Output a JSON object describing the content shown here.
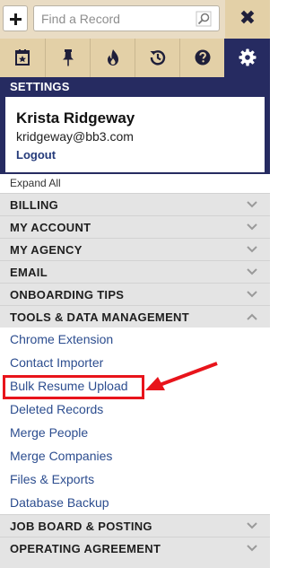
{
  "toolbar": {
    "add_label": "+",
    "search_placeholder": "Find a Record",
    "close_label": "✖"
  },
  "tabs": [
    {
      "icon": "calendar-star-icon"
    },
    {
      "icon": "pin-icon"
    },
    {
      "icon": "flame-icon"
    },
    {
      "icon": "history-icon"
    },
    {
      "icon": "help-icon"
    },
    {
      "icon": "gear-icon",
      "active": true
    }
  ],
  "settings": {
    "header": "SETTINGS",
    "profile": {
      "name": "Krista Ridgeway",
      "email": "kridgeway@bb3.com",
      "logout": "Logout"
    },
    "expand_all": "Expand All"
  },
  "menu": {
    "billing": "BILLING",
    "my_account": "MY ACCOUNT",
    "my_agency": "MY AGENCY",
    "email": "EMAIL",
    "onboarding_tips": "ONBOARDING TIPS",
    "tools": {
      "label": "TOOLS & DATA MANAGEMENT",
      "expanded": true,
      "items": [
        "Chrome Extension",
        "Contact Importer",
        "Bulk Resume Upload",
        "Deleted Records",
        "Merge People",
        "Merge Companies",
        "Files & Exports",
        "Database Backup"
      ]
    },
    "job_board": "JOB BOARD & POSTING",
    "operating_agreement": "OPERATING AGREEMENT"
  },
  "colors": {
    "navy": "#262b61",
    "tan": "#e3d0a7",
    "link": "#2c4d8f",
    "highlight": "#e8141b"
  }
}
